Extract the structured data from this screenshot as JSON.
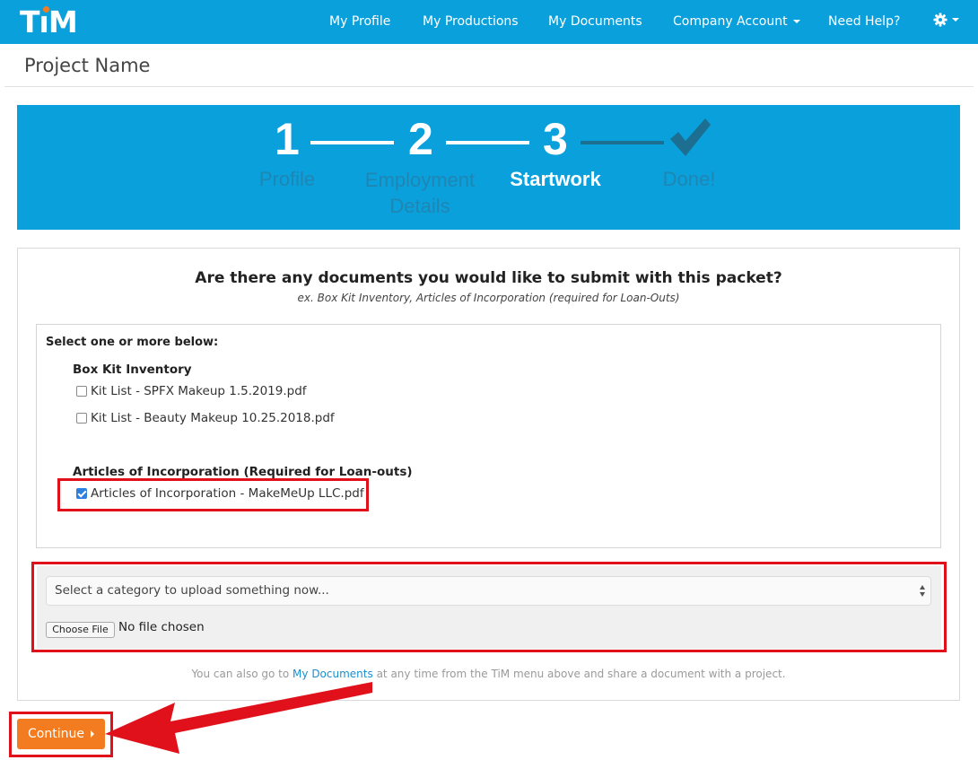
{
  "nav": {
    "logo": "TiM",
    "items": [
      {
        "label": "My Profile"
      },
      {
        "label": "My Productions"
      },
      {
        "label": "My Documents"
      },
      {
        "label": "Company Account"
      },
      {
        "label": "Need Help?"
      }
    ],
    "settings_icon": "gear-icon"
  },
  "page": {
    "title": "Project Name"
  },
  "progress": {
    "steps": [
      {
        "number": "1",
        "label_lines": [
          "Profile"
        ],
        "state": "complete"
      },
      {
        "number": "2",
        "label_lines": [
          "Employment",
          "Details"
        ],
        "state": "complete"
      },
      {
        "number": "3",
        "label_lines": [
          "Startwork"
        ],
        "state": "current"
      },
      {
        "number": "✔",
        "label_lines": [
          "Done!"
        ],
        "state": "pending"
      }
    ]
  },
  "documents": {
    "question": "Are there any documents you would like to submit with this packet?",
    "hint": "ex. Box Kit Inventory, Articles of Incorporation (required for Loan-Outs)",
    "select_heading": "Select one or more below:",
    "groups": [
      {
        "heading": "Box Kit Inventory",
        "items": [
          {
            "label": "Kit List - SPFX Makeup 1.5.2019.pdf",
            "checked": false
          },
          {
            "label": "Kit List - Beauty Makeup 10.25.2018.pdf",
            "checked": false
          }
        ]
      },
      {
        "heading": "Articles of Incorporation (Required for Loan-outs)",
        "items": [
          {
            "label": "Articles of Incorporation - MakeMeUp LLC.pdf",
            "checked": true
          }
        ]
      }
    ]
  },
  "upload": {
    "category_placeholder": "Select a category to upload something now...",
    "choose_file": "Choose File",
    "no_file": "No file chosen"
  },
  "footer_note": {
    "before": "You can also go to ",
    "link": "My Documents",
    "after": " at any time from the TiM menu above and share a document with a project."
  },
  "continue_label": "Continue",
  "colors": {
    "brand_blue": "#0aa0dc",
    "muted_step": "#1f86b3",
    "accent_orange": "#f47c20",
    "annotation_red": "#e0111b",
    "link_blue": "#1a8fd0"
  }
}
